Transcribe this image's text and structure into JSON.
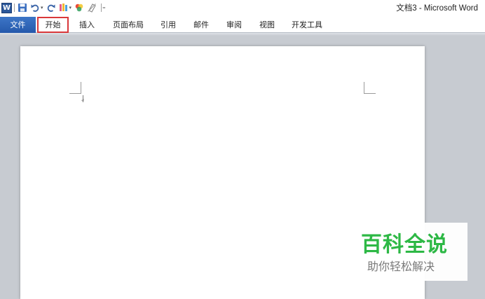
{
  "app": {
    "window_title": "文档3 - Microsoft Word",
    "logo_letter": "W"
  },
  "quick_access": {
    "icons": [
      "save-icon",
      "undo-icon",
      "redo-icon",
      "format-painter-icon",
      "color-icon",
      "clear-format-icon",
      "customize-icon"
    ]
  },
  "ribbon": {
    "file_tab": "文件",
    "tabs": [
      "开始",
      "插入",
      "页面布局",
      "引用",
      "邮件",
      "审阅",
      "视图",
      "开发工具"
    ]
  },
  "document": {
    "paragraph_mark": "↵"
  },
  "watermark": {
    "title": "百科全说",
    "subtitle": "助你轻松解决"
  },
  "colors": {
    "accent": "#2b579a",
    "file_tab": "#2b5fb4",
    "highlight_box": "#d9383a",
    "watermark_green": "#2db845"
  }
}
